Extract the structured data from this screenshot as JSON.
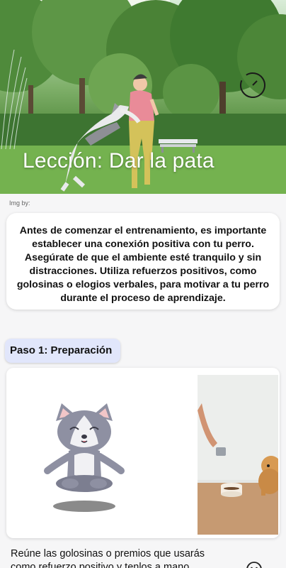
{
  "hero": {
    "title": "Lección: Dar la pata",
    "action_icon": "timer-icon"
  },
  "image_credit": "Img by:",
  "intro_text": "Antes de comenzar el entrenamiento, es importante establecer una conexión positiva con tu perro. Asegúrate de que el ambiente esté tranquilo y sin distracciones. Utiliza refuerzos positivos, como golosinas o elogios verbales, para motivar a tu perro durante el proceso de aprendizaje.",
  "step": {
    "title": "Paso 1: Preparación",
    "description": "Reúne las golosinas o premios que usarás como refuerzo positivo y tenlos a mano.",
    "mascot_icon": "meditating-dog-icon",
    "photo": "dog-with-treat-bowl-photo",
    "side_icon": "smiley-icon"
  },
  "colors": {
    "chip_bg": "#e1e6fb",
    "card_bg": "#ffffff",
    "page_bg": "#f6f6f7"
  }
}
